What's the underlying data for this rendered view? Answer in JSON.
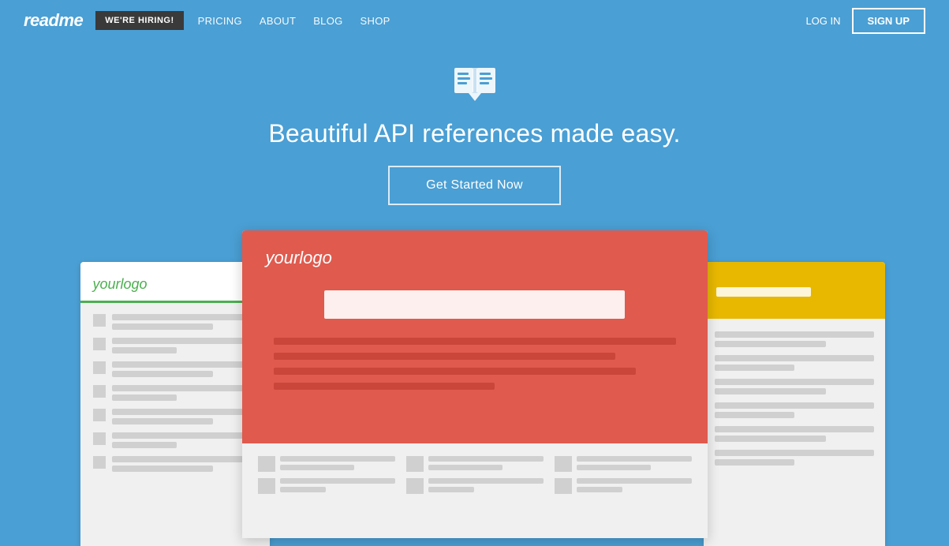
{
  "nav": {
    "logo": "readme",
    "hiring_label": "WE'RE HIRING!",
    "links": [
      {
        "label": "PRICING",
        "href": "#"
      },
      {
        "label": "ABOUT",
        "href": "#"
      },
      {
        "label": "BLOG",
        "href": "#"
      },
      {
        "label": "SHOP",
        "href": "#"
      }
    ],
    "login_label": "LOG IN",
    "signup_label": "SIGN UP"
  },
  "hero": {
    "title": "Beautiful API references made easy.",
    "cta_label": "Get Started Now"
  },
  "mockup": {
    "left_logo": "yourlogo",
    "center_logo": "yourlogo",
    "right_bar_color": "#e8b800",
    "center_header_color": "#e05a4e",
    "green_accent": "#4CAF50"
  }
}
